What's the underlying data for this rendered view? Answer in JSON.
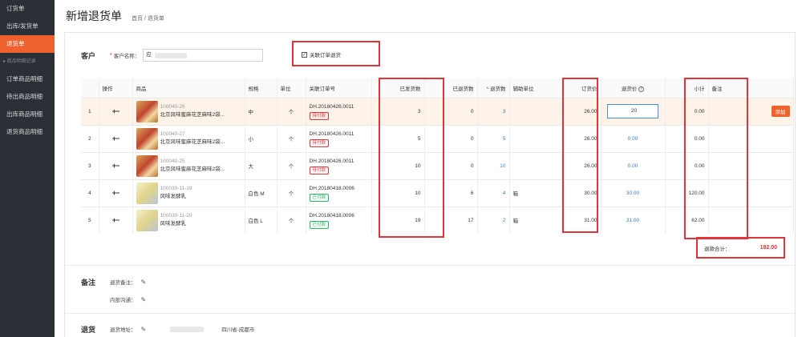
{
  "sidebar": {
    "items": [
      {
        "label": "订货单",
        "active": false
      },
      {
        "label": "出库/发货单",
        "active": false
      },
      {
        "label": "退货单",
        "active": true
      }
    ],
    "group_label": "商品明细记录",
    "sub_items": [
      {
        "label": "订单商品明细"
      },
      {
        "label": "待出商品明细"
      },
      {
        "label": "出库商品明细"
      },
      {
        "label": "退货商品明细"
      }
    ]
  },
  "header": {
    "title": "新增退货单",
    "breadcrumb": "首页 / 退货单"
  },
  "customer": {
    "section_label": "客户",
    "required_mark": "*",
    "name_label": "客户名称：",
    "name_value": "应",
    "link_order_label": "关联订单退货",
    "link_order_checked": true
  },
  "table": {
    "headers": {
      "index": "",
      "ops": "操作",
      "product": "商品",
      "spec": "规格",
      "unit": "单位",
      "order_no": "关联订单号",
      "shipped": "已发货数",
      "returned": "已退货数",
      "return_qty": "退货数",
      "aux_unit": "辅助单位",
      "order_price": "订货价",
      "return_price": "退货价",
      "subtotal": "小计",
      "remark": "备注"
    },
    "return_qty_required": "*",
    "ops_glyph": "+−",
    "add_label": "添加",
    "rows": [
      {
        "index": "1",
        "sku": "100040-26",
        "name": "北京风味蜜麻花芝麻味2袋...",
        "spec": "中",
        "unit": "个",
        "order_no": "DH.20180426.0011",
        "status": "待付款",
        "paid": false,
        "shipped": "3",
        "returned": "0",
        "return_qty": "3",
        "aux_unit": "",
        "order_price": "26.00",
        "return_price": "20",
        "subtotal": "0.00",
        "img": "snack"
      },
      {
        "index": "2",
        "sku": "100040-27",
        "name": "北京风味蜜麻花芝麻味2袋...",
        "spec": "小",
        "unit": "个",
        "order_no": "DH.20180426.0011",
        "status": "待付款",
        "paid": false,
        "shipped": "5",
        "returned": "0",
        "return_qty": "5",
        "aux_unit": "",
        "order_price": "26.00",
        "return_price": "0.00",
        "subtotal": "0.00",
        "img": "snack"
      },
      {
        "index": "3",
        "sku": "100040-25",
        "name": "北京风味蜜麻花芝麻味2袋...",
        "spec": "大",
        "unit": "个",
        "order_no": "DH.20180426.0011",
        "status": "待付款",
        "paid": false,
        "shipped": "10",
        "returned": "0",
        "return_qty": "10",
        "aux_unit": "",
        "order_price": "26.00",
        "return_price": "0.00",
        "subtotal": "0.00",
        "img": "snack"
      },
      {
        "index": "4",
        "sku": "100030-11-19",
        "name": "风味发酵乳",
        "spec": "白色 M",
        "unit": "个",
        "order_no": "DH.20180418.0006",
        "status": "已付款",
        "paid": true,
        "shipped": "10",
        "returned": "6",
        "return_qty": "4",
        "aux_unit": "箱",
        "order_price": "30.00",
        "return_price": "30.00",
        "subtotal": "120.00",
        "img": "yog"
      },
      {
        "index": "5",
        "sku": "100030-11-20",
        "name": "风味发酵乳",
        "spec": "白色 L",
        "unit": "个",
        "order_no": "DH.20180418.0006",
        "status": "已付款",
        "paid": true,
        "shipped": "19",
        "returned": "17",
        "return_qty": "2",
        "aux_unit": "箱",
        "order_price": "31.00",
        "return_price": "31.00",
        "subtotal": "62.00",
        "img": "yog"
      }
    ]
  },
  "total": {
    "label": "退款合计：",
    "value": "182.00"
  },
  "remarks": {
    "section_label": "备注",
    "return_note_label": "退货备注：",
    "internal_label": "内部沟通："
  },
  "return_goods": {
    "section_label": "退货",
    "address_label": "退货地址：",
    "address_value": "四川省-成都市"
  },
  "colors": {
    "accent": "#f0622d",
    "highlight": "#e2333b",
    "link": "#3a7ac7",
    "sidebar_bg": "#2b2f36"
  }
}
